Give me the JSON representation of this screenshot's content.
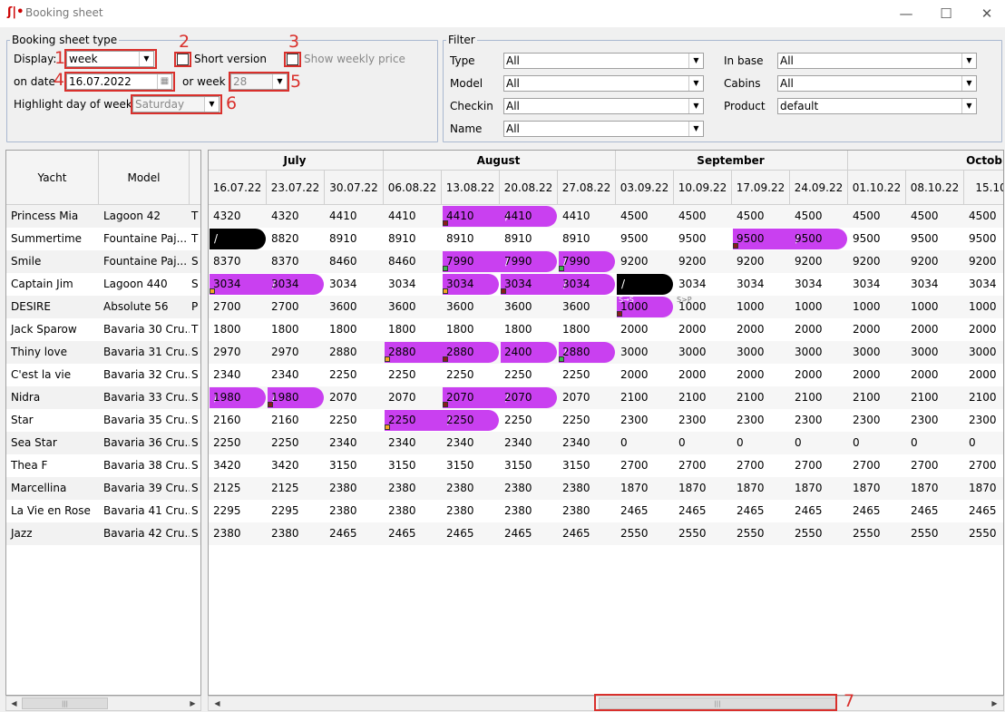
{
  "window": {
    "title": "Booking sheet",
    "logo": "ʃ|•",
    "minimize": "—",
    "maximize": "☐",
    "close": "✕"
  },
  "booking": {
    "legend": "Booking sheet type",
    "display_label": "Display:",
    "display_value": "week",
    "short_version": "Short version",
    "show_weekly_price": "Show weekly price",
    "on_date_label": "on date",
    "on_date_value": "16.07.2022",
    "or_week_label": "or week",
    "week_value": "28",
    "highlight_label": "Highlight day of week",
    "highlight_value": "Saturday"
  },
  "filter": {
    "legend": "Filter",
    "type_label": "Type",
    "type_value": "All",
    "model_label": "Model",
    "model_value": "All",
    "checkin_label": "Checkin",
    "checkin_value": "All",
    "name_label": "Name",
    "name_value": "All",
    "inbase_label": "In base",
    "inbase_value": "All",
    "cabins_label": "Cabins",
    "cabins_value": "All",
    "product_label": "Product",
    "product_value": "default"
  },
  "annotations": [
    "1",
    "2",
    "3",
    "4",
    "5",
    "6",
    "7"
  ],
  "left_headers": {
    "yacht": "Yacht",
    "model": "Model"
  },
  "yachts": [
    {
      "name": "Princess Mia",
      "model": "Lagoon 42",
      "t": "T"
    },
    {
      "name": "Summertime",
      "model": "Fountaine Paj...",
      "t": "T"
    },
    {
      "name": "Smile",
      "model": "Fountaine Paj...",
      "t": "S"
    },
    {
      "name": "Captain Jim",
      "model": "Lagoon 440",
      "t": "S"
    },
    {
      "name": "DESIRE",
      "model": "Absolute 56",
      "t": "P"
    },
    {
      "name": "Jack Sparow",
      "model": "Bavaria 30 Cru...",
      "t": "T"
    },
    {
      "name": "Thiny love",
      "model": "Bavaria 31 Cru...",
      "t": "S"
    },
    {
      "name": "C'est la vie",
      "model": "Bavaria 32 Cru...",
      "t": "S"
    },
    {
      "name": "Nidra",
      "model": "Bavaria 33 Cru...",
      "t": "S"
    },
    {
      "name": "Star",
      "model": "Bavaria 35 Cru...",
      "t": "S"
    },
    {
      "name": "Sea Star",
      "model": "Bavaria 36 Cru...",
      "t": "S"
    },
    {
      "name": "Thea F",
      "model": "Bavaria 38 Cru...",
      "t": "S"
    },
    {
      "name": "Marcellina",
      "model": "Bavaria 39 Cru...",
      "t": "S"
    },
    {
      "name": "La Vie en Rose",
      "model": "Bavaria 41 Cru...",
      "t": "S"
    },
    {
      "name": "Jazz",
      "model": "Bavaria 42 Cru...",
      "t": "S"
    }
  ],
  "months": [
    "July",
    "August",
    "September",
    "Octob"
  ],
  "weeks": [
    "16.07.22",
    "23.07.22",
    "30.07.22",
    "06.08.22",
    "13.08.22",
    "20.08.22",
    "27.08.22",
    "03.09.22",
    "10.09.22",
    "17.09.22",
    "24.09.22",
    "01.10.22",
    "08.10.22",
    "15.10."
  ],
  "prices": [
    [
      "4320",
      "4320",
      "4410",
      "4410",
      "4410",
      "4410",
      "4410",
      "4500",
      "4500",
      "4500",
      "4500",
      "4500",
      "4500",
      "4500"
    ],
    [
      "",
      "8820",
      "8910",
      "8910",
      "8910",
      "8910",
      "8910",
      "9500",
      "9500",
      "9500",
      "9500",
      "9500",
      "9500",
      "9500"
    ],
    [
      "8370",
      "8370",
      "8460",
      "8460",
      "7990",
      "7990",
      "7990",
      "9200",
      "9200",
      "9200",
      "9200",
      "9200",
      "9200",
      "9200"
    ],
    [
      "3034",
      "3034",
      "3034",
      "3034",
      "3034",
      "3034",
      "3034",
      "",
      "3034",
      "3034",
      "3034",
      "3034",
      "3034",
      "3034"
    ],
    [
      "2700",
      "2700",
      "3600",
      "3600",
      "3600",
      "3600",
      "3600",
      "1000",
      "1000",
      "1000",
      "1000",
      "1000",
      "1000",
      "1000"
    ],
    [
      "1800",
      "1800",
      "1800",
      "1800",
      "1800",
      "1800",
      "1800",
      "2000",
      "2000",
      "2000",
      "2000",
      "2000",
      "2000",
      "2000"
    ],
    [
      "2970",
      "2970",
      "2880",
      "2880",
      "2880",
      "2400",
      "2880",
      "3000",
      "3000",
      "3000",
      "3000",
      "3000",
      "3000",
      "3000"
    ],
    [
      "2340",
      "2340",
      "2250",
      "2250",
      "2250",
      "2250",
      "2250",
      "2000",
      "2000",
      "2000",
      "2000",
      "2000",
      "2000",
      "2000"
    ],
    [
      "1980",
      "1980",
      "2070",
      "2070",
      "2070",
      "2070",
      "2070",
      "2100",
      "2100",
      "2100",
      "2100",
      "2100",
      "2100",
      "2100"
    ],
    [
      "2160",
      "2160",
      "2250",
      "2250",
      "2250",
      "2250",
      "2250",
      "2300",
      "2300",
      "2300",
      "2300",
      "2300",
      "2300",
      "2300"
    ],
    [
      "2250",
      "2250",
      "2340",
      "2340",
      "2340",
      "2340",
      "2340",
      "0",
      "0",
      "0",
      "0",
      "0",
      "0",
      "0"
    ],
    [
      "3420",
      "3420",
      "3150",
      "3150",
      "3150",
      "3150",
      "3150",
      "2700",
      "2700",
      "2700",
      "2700",
      "2700",
      "2700",
      "2700"
    ],
    [
      "2125",
      "2125",
      "2380",
      "2380",
      "2380",
      "2380",
      "2380",
      "1870",
      "1870",
      "1870",
      "1870",
      "1870",
      "1870",
      "1870"
    ],
    [
      "2295",
      "2295",
      "2380",
      "2380",
      "2380",
      "2380",
      "2380",
      "2465",
      "2465",
      "2465",
      "2465",
      "2465",
      "2465",
      "2465"
    ],
    [
      "2380",
      "2380",
      "2465",
      "2465",
      "2465",
      "2465",
      "2465",
      "2550",
      "2550",
      "2550",
      "2550",
      "2550",
      "2550",
      "2550"
    ]
  ],
  "small_labels": {
    "sos": "S→S",
    "sop": "S>P"
  },
  "scroll": {
    "grip": "|||",
    "left": "◀",
    "right": "▶"
  },
  "colors": {
    "booking": "#c940f0",
    "blocked": "#000000",
    "annotation": "#d9302c",
    "band": "#e6e6e6"
  }
}
